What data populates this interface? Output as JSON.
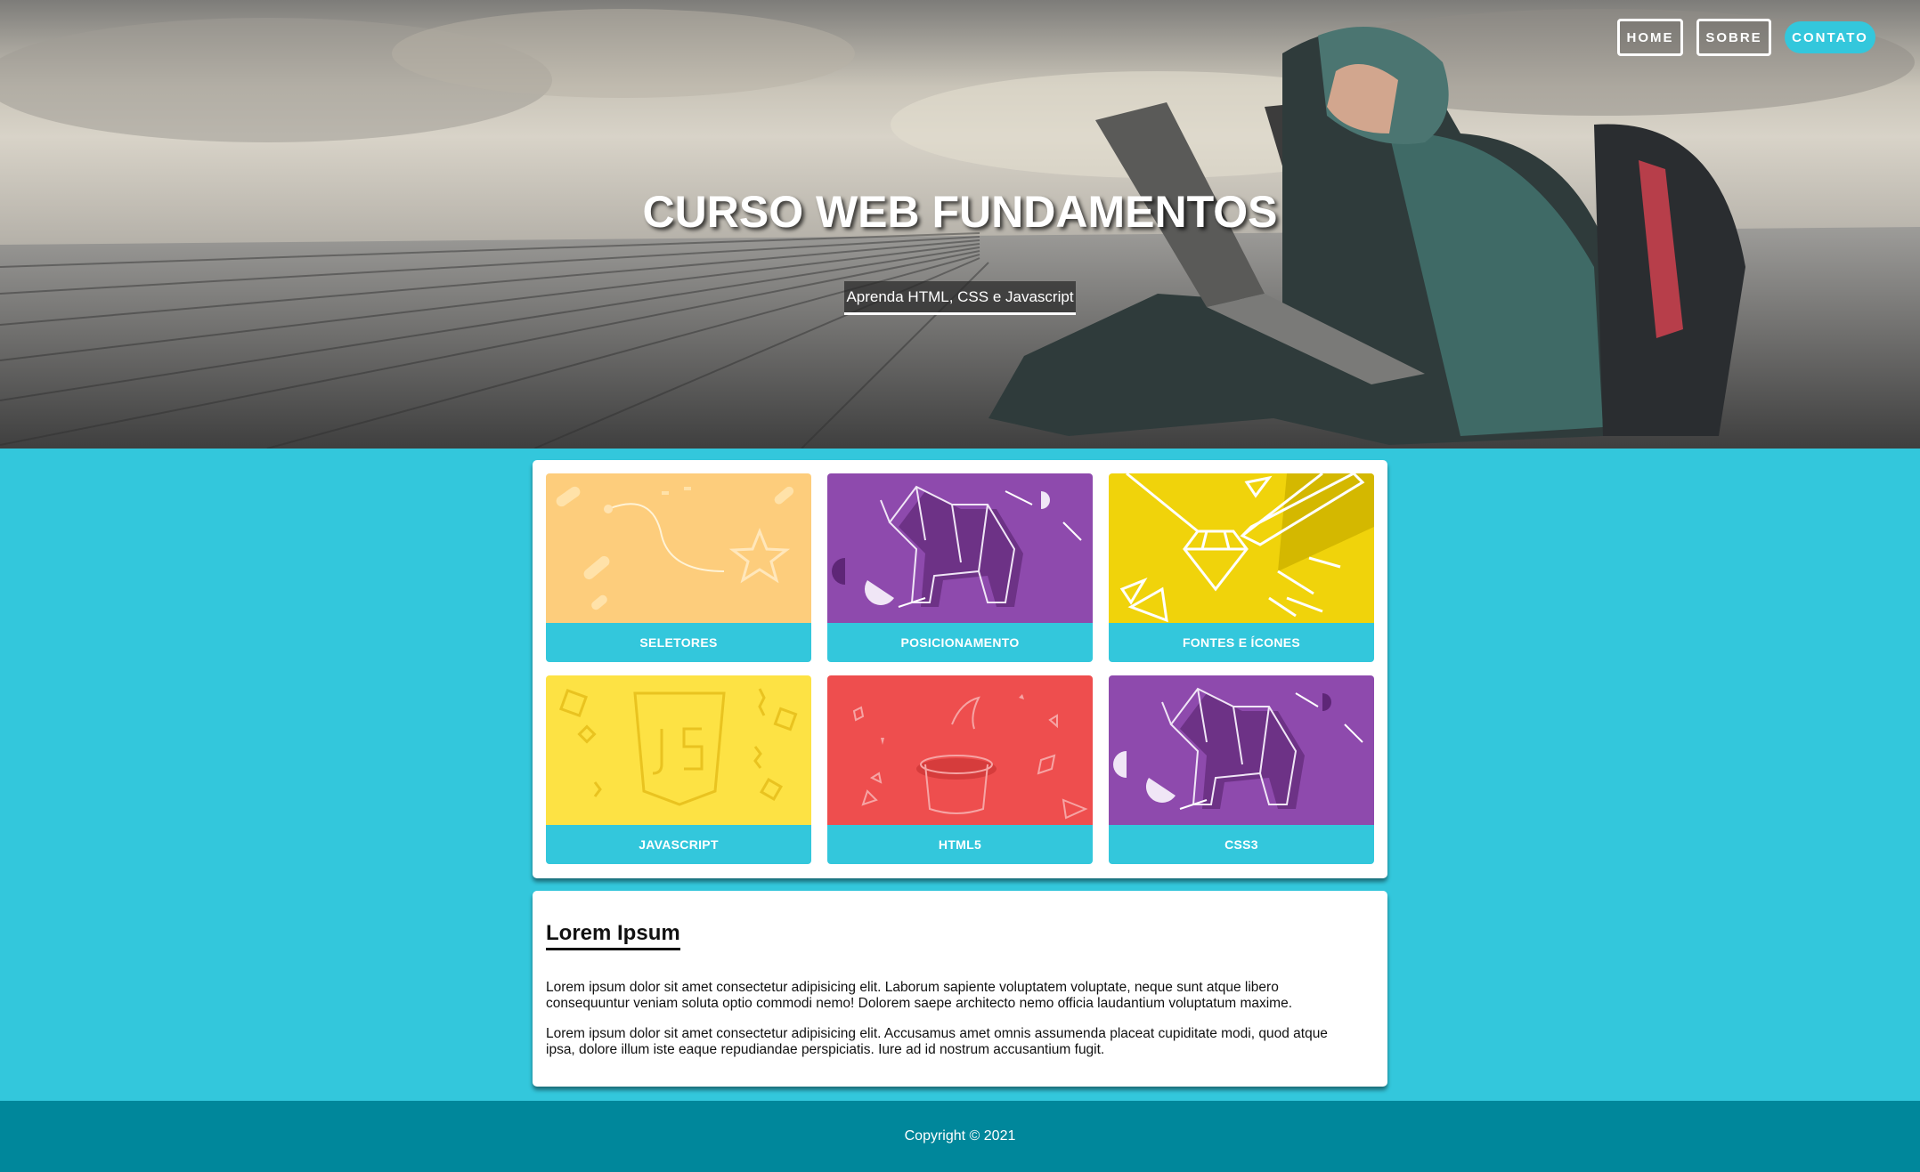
{
  "nav": {
    "home": "HOME",
    "sobre": "SOBRE",
    "contato": "CONTATO"
  },
  "hero": {
    "title": "CURSO WEB FUNDAMENTOS",
    "subtitle": "Aprenda HTML, CSS e Javascript"
  },
  "cards": [
    {
      "label": "SELETORES",
      "color": "#fdcd7c"
    },
    {
      "label": "POSICIONAMENTO",
      "color": "#8e4aad"
    },
    {
      "label": "FONTES E ÍCONES",
      "color": "#f0d30b"
    },
    {
      "label": "JAVASCRIPT",
      "color": "#fde244"
    },
    {
      "label": "HTML5",
      "color": "#ee4e4e"
    },
    {
      "label": "CSS3",
      "color": "#8e4aad"
    }
  ],
  "content": {
    "title": "Lorem Ipsum",
    "paragraph1": "Lorem ipsum dolor sit amet consectetur adipisicing elit. Laborum sapiente voluptatem voluptate, neque sunt atque libero consequuntur veniam soluta optio commodi nemo! Dolorem saepe architecto nemo officia laudantium voluptatum maxime.",
    "paragraph2": "Lorem ipsum dolor sit amet consectetur adipisicing elit. Accusamus amet omnis assumenda placeat cupiditate modi, quod atque ipsa, dolore illum iste eaque repudiandae perspiciatis. Iure ad id nostrum accusantium fugit."
  },
  "footer": {
    "copyright": "Copyright © 2021"
  },
  "colors": {
    "accent": "#33c7dc",
    "footer": "#00879b"
  }
}
